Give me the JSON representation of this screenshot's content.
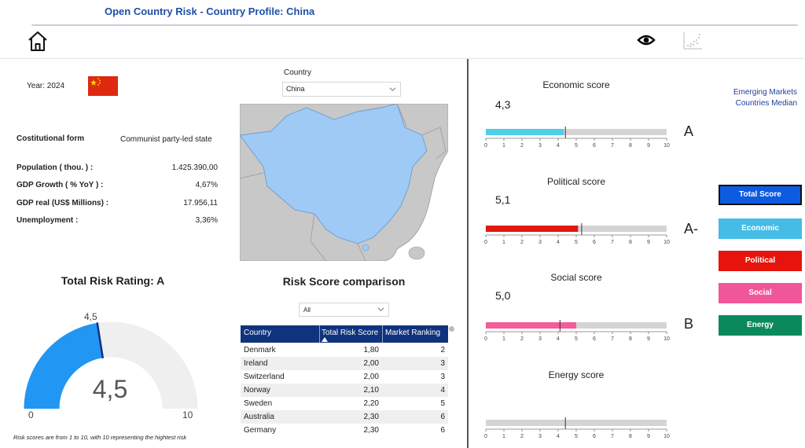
{
  "header": {
    "title": "Open Country Risk - Country Profile: China"
  },
  "toolbar": {
    "home_icon": "home-icon",
    "eye_icon": "eye-icon",
    "scatter_icon": "scatter-chart-icon"
  },
  "profile": {
    "year_label": "Year: 2024",
    "rows": [
      {
        "key": "Costitutional form",
        "value": "Communist party-led state"
      },
      {
        "key": "Population ( thou. ) :",
        "value": "1.425.390,00"
      },
      {
        "key": "GDP Growth ( % YoY ) :",
        "value": "4,67%"
      },
      {
        "key": "GDP real (US$ Millions) :",
        "value": "17.956,11"
      },
      {
        "key": "Unemployment :",
        "value": "3,36%"
      }
    ]
  },
  "country_filter": {
    "label": "Country",
    "value": "China"
  },
  "gauge": {
    "title": "Total Risk Rating: A",
    "value": 4.5,
    "value_label": "4,5",
    "marker_label": "4,5",
    "min_label": "0",
    "max_label": "10",
    "min": 0,
    "max": 10,
    "fill_color": "#2196f3",
    "track_color": "#efefef",
    "footnote": "Risk scores are from 1 to 10, with 10 representing the hightest risk"
  },
  "comparison": {
    "title": "Risk Score comparison",
    "filter_value": "All",
    "headers": [
      "Country",
      "Total Risk Score",
      "Market Ranking"
    ],
    "rows": [
      [
        "Denmark",
        "1,80",
        "2"
      ],
      [
        "Ireland",
        "2,00",
        "3"
      ],
      [
        "Switzerland",
        "2,00",
        "3"
      ],
      [
        "Norway",
        "2,10",
        "4"
      ],
      [
        "Sweden",
        "2,20",
        "5"
      ],
      [
        "Australia",
        "2,30",
        "6"
      ],
      [
        "Germany",
        "2,30",
        "6"
      ]
    ]
  },
  "scores": [
    {
      "title": "Economic score",
      "value_label": "4,3",
      "value": 4.3,
      "median": 4.4,
      "grade": "A",
      "color": "#4dd0e8"
    },
    {
      "title": "Political score",
      "value_label": "5,1",
      "value": 5.1,
      "median": 5.3,
      "grade": "A-",
      "color": "#e0180e"
    },
    {
      "title": "Social score",
      "value_label": "5,0",
      "value": 5.0,
      "median": 4.1,
      "grade": "B",
      "color": "#f45c9a"
    },
    {
      "title": "Energy score",
      "value_label": "",
      "value": null,
      "median": 4.4,
      "grade": "",
      "color": "#0e8a5a"
    }
  ],
  "axis_ticks": [
    "0",
    "1",
    "2",
    "3",
    "4",
    "5",
    "6",
    "7",
    "8",
    "9",
    "10"
  ],
  "median_label": "Emerging Markets Countries Median",
  "side_buttons": [
    {
      "label": "Total Score",
      "color": "#0d5be0"
    },
    {
      "label": "Economic",
      "color": "#44bce6"
    },
    {
      "label": "Political",
      "color": "#e6140c"
    },
    {
      "label": "Social",
      "color": "#f2569a"
    },
    {
      "label": "Energy",
      "color": "#0a8a5c"
    }
  ]
}
